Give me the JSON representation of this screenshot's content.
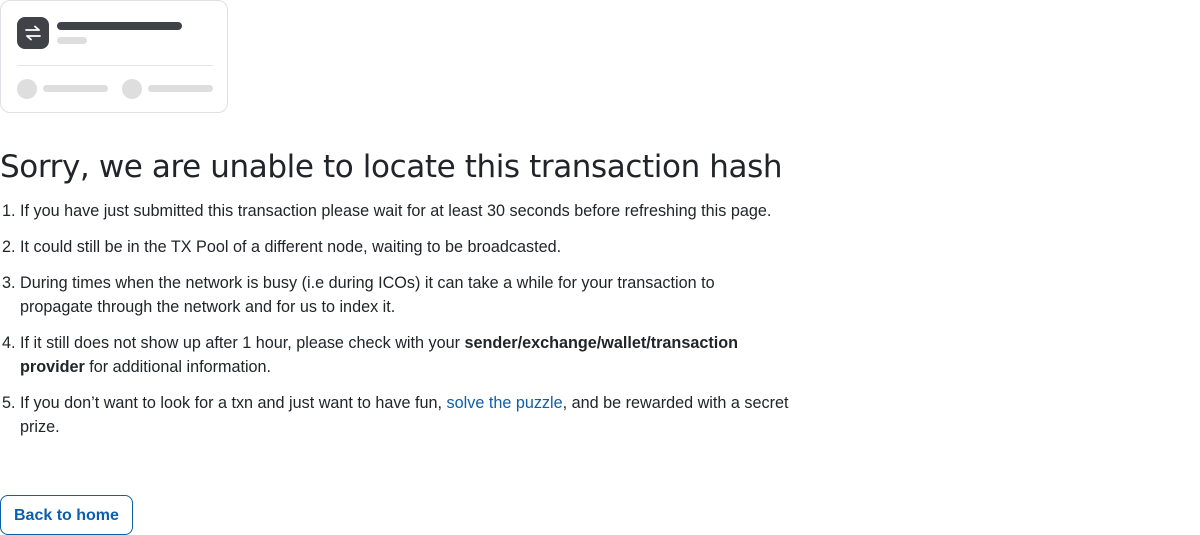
{
  "heading": "Sorry, we are unable to locate this transaction hash",
  "reasons": [
    {
      "text": "If you have just submitted this transaction please wait for at least 30 seconds before refreshing this page."
    },
    {
      "text": "It could still be in the TX Pool of a different node, waiting to be broadcasted."
    },
    {
      "text": "During times when the network is busy (i.e during ICOs) it can take a while for your transaction to propagate through the network and for us to index it."
    },
    {
      "before": "If it still does not show up after 1 hour, please check with your ",
      "bold": "sender/exchange/wallet/transaction provider",
      "after": " for additional information."
    },
    {
      "before": "If you don’t want to look for a txn and just want to have fun, ",
      "link": "solve the puzzle",
      "after": ", and be rewarded with a secret prize."
    }
  ],
  "button": {
    "label": "Back to home"
  },
  "illustration": {
    "icon": "swap-arrows-icon"
  },
  "colors": {
    "link": "#0d5fa8",
    "text": "#212529",
    "icon_bg": "#3f4347",
    "placeholder": "#dedede"
  }
}
